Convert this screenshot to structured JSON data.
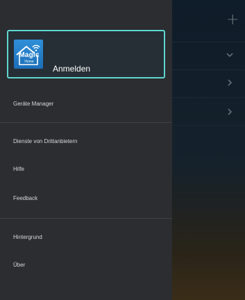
{
  "background": {
    "icons": [
      "plus-icon",
      "chevron-down-icon",
      "chevron-right-icon",
      "chevron-right-icon"
    ]
  },
  "login": {
    "logo_word": "Magic",
    "logo_sub": "Home",
    "label": "Anmelden"
  },
  "menu": {
    "item_device_manager": "Geräte Manager",
    "item_third_party": "Dienste von Drittanbietern",
    "item_help": "Hilfe",
    "item_feedback": "Feedback",
    "item_background": "Hintergrund",
    "item_about": "Über"
  },
  "colors": {
    "drawer_bg": "#2b2d30",
    "accent_border": "#5fd7cf",
    "logo_blue": "#1c6fb8",
    "text": "#d6d8da"
  }
}
